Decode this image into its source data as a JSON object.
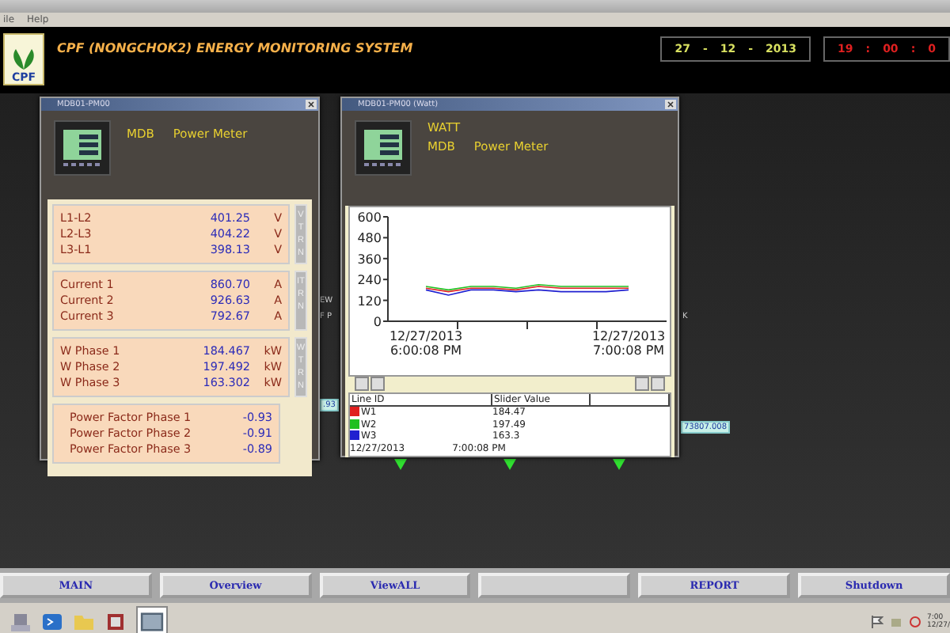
{
  "menu": [
    "ile",
    "Help"
  ],
  "header": {
    "title": "CPF (NONGCHOK2) ENERGY MONITORING SYSTEM",
    "logo_text": "CPF",
    "date": [
      "27",
      "-",
      "12",
      "-",
      "2013"
    ],
    "time": [
      "19",
      ":",
      "00",
      ":",
      "0"
    ]
  },
  "background_labels": [
    {
      "text": "EW",
      "kind": "plain"
    },
    {
      "text": "F P",
      "kind": "plain"
    },
    {
      "text": "K",
      "kind": "plain"
    },
    {
      "text": ".93",
      "kind": "value"
    },
    {
      "text": "73807.008",
      "kind": "value"
    }
  ],
  "meter_window": {
    "title": "MDB01-PM00",
    "mdb_label": "MDB",
    "meter_label": "Power Meter",
    "groups": [
      {
        "button": "VTRN",
        "rows": [
          {
            "label": "L1-L2",
            "value": "401.25",
            "unit": "V"
          },
          {
            "label": "L2-L3",
            "value": "404.22",
            "unit": "V"
          },
          {
            "label": "L3-L1",
            "value": "398.13",
            "unit": "V"
          }
        ]
      },
      {
        "button": "ITRN",
        "rows": [
          {
            "label": "Current 1",
            "value": "860.70",
            "unit": "A"
          },
          {
            "label": "Current 2",
            "value": "926.63",
            "unit": "A"
          },
          {
            "label": "Current 3",
            "value": "792.67",
            "unit": "A"
          }
        ]
      },
      {
        "button": "WTRN",
        "rows": [
          {
            "label": "W Phase 1",
            "value": "184.467",
            "unit": "kW"
          },
          {
            "label": "W Phase 2",
            "value": "197.492",
            "unit": "kW"
          },
          {
            "label": "W Phase 3",
            "value": "163.302",
            "unit": "kW"
          }
        ]
      },
      {
        "rows": [
          {
            "label": "Power Factor Phase 1",
            "value": "-0.93"
          },
          {
            "label": "Power Factor Phase 2",
            "value": "-0.91"
          },
          {
            "label": "Power Factor Phase 3",
            "value": "-0.89"
          }
        ]
      }
    ]
  },
  "trend_window": {
    "title": "MDB01-PM00 (Watt)",
    "kind_label": "WATT",
    "mdb_label": "MDB",
    "meter_label": "Power Meter",
    "chart_data": {
      "type": "line",
      "categories": [
        "12/27/2013 6:00:08 PM",
        null,
        null,
        null,
        null,
        null,
        null,
        null,
        null,
        "12/27/2013 7:00:08 PM"
      ],
      "ylim": [
        0,
        600
      ],
      "yticks": [
        0,
        120,
        240,
        360,
        480,
        600
      ],
      "series": [
        {
          "name": "W1",
          "color": "#e02020",
          "values": [
            190,
            170,
            190,
            190,
            180,
            200,
            190,
            190,
            190,
            190
          ]
        },
        {
          "name": "W2",
          "color": "#20c020",
          "values": [
            200,
            180,
            200,
            200,
            190,
            210,
            200,
            200,
            200,
            200
          ]
        },
        {
          "name": "W3",
          "color": "#2020d0",
          "values": [
            180,
            150,
            180,
            180,
            170,
            180,
            170,
            170,
            170,
            180
          ]
        }
      ]
    },
    "legend_headers": [
      "Line ID",
      "Slider Value"
    ],
    "legend": [
      {
        "value": "184.47"
      },
      {
        "value": "197.49"
      },
      {
        "value": "163.3"
      }
    ],
    "slider_date": "12/27/2013",
    "slider_time": "7:00:08 PM"
  },
  "nav_buttons": [
    {
      "kind": "text",
      "label": "MAIN"
    },
    {
      "kind": "text",
      "label": "Overview"
    },
    {
      "kind": "text",
      "label": "ViewALL"
    },
    {
      "kind": "blank"
    },
    {
      "kind": "text",
      "label": "REPORT"
    },
    {
      "kind": "text",
      "label": "Shutdown"
    }
  ],
  "tray_clock": [
    "7:00",
    "12/27/"
  ]
}
